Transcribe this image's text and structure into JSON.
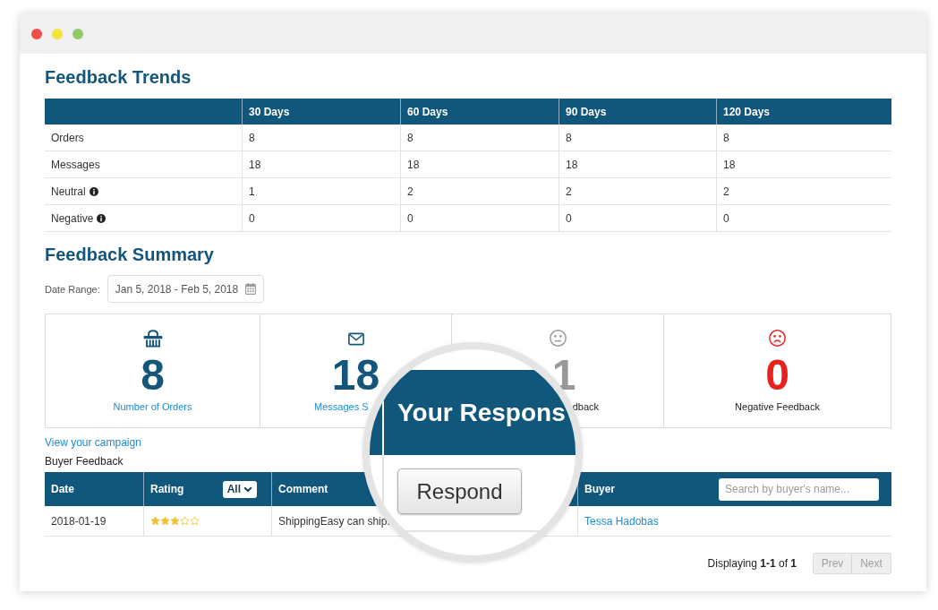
{
  "feedback_trends": {
    "title": "Feedback Trends",
    "columns": [
      "30 Days",
      "60 Days",
      "90 Days",
      "120 Days"
    ],
    "rows": [
      {
        "label": "Orders",
        "info": false,
        "values": [
          "8",
          "8",
          "8",
          "8"
        ]
      },
      {
        "label": "Messages",
        "info": false,
        "values": [
          "18",
          "18",
          "18",
          "18"
        ]
      },
      {
        "label": "Neutral",
        "info": true,
        "values": [
          "1",
          "2",
          "2",
          "2"
        ]
      },
      {
        "label": "Negative",
        "info": true,
        "values": [
          "0",
          "0",
          "0",
          "0"
        ]
      }
    ]
  },
  "feedback_summary": {
    "title": "Feedback Summary",
    "date_range": {
      "label": "Date Range:",
      "value": "Jan 5, 2018 - Feb 5, 2018"
    },
    "stats": [
      {
        "kind": "orders",
        "value": "8",
        "label": "Number of Orders",
        "link": true
      },
      {
        "kind": "messages",
        "value": "18",
        "label": "Messages S",
        "link": true
      },
      {
        "kind": "neutral",
        "value": "1",
        "label": "dback",
        "link": false
      },
      {
        "kind": "negative",
        "value": "0",
        "label": "Negative Feedback",
        "link": false
      }
    ],
    "campaign_link": "View your campaign"
  },
  "buyer_feedback": {
    "title": "Buyer Feedback",
    "columns": [
      {
        "label": "Date"
      },
      {
        "label": "Rating",
        "filter": "All"
      },
      {
        "label": "Comment"
      },
      {
        "label": "Buyer",
        "search_placeholder": "Search by buyer's name..."
      }
    ],
    "rows": [
      {
        "date": "2018-01-19",
        "stars": 3,
        "comment": "ShippingEasy can ship.",
        "buyer": "Tessa Hadobas"
      }
    ],
    "pagination": {
      "summary": "Displaying **1-1** of **1**",
      "buttons": [
        {
          "label": "Prev",
          "disabled": true
        },
        {
          "label": "Next",
          "disabled": true
        }
      ]
    }
  },
  "magnifier": {
    "column_header": "Your Respons",
    "button": "Respond"
  }
}
